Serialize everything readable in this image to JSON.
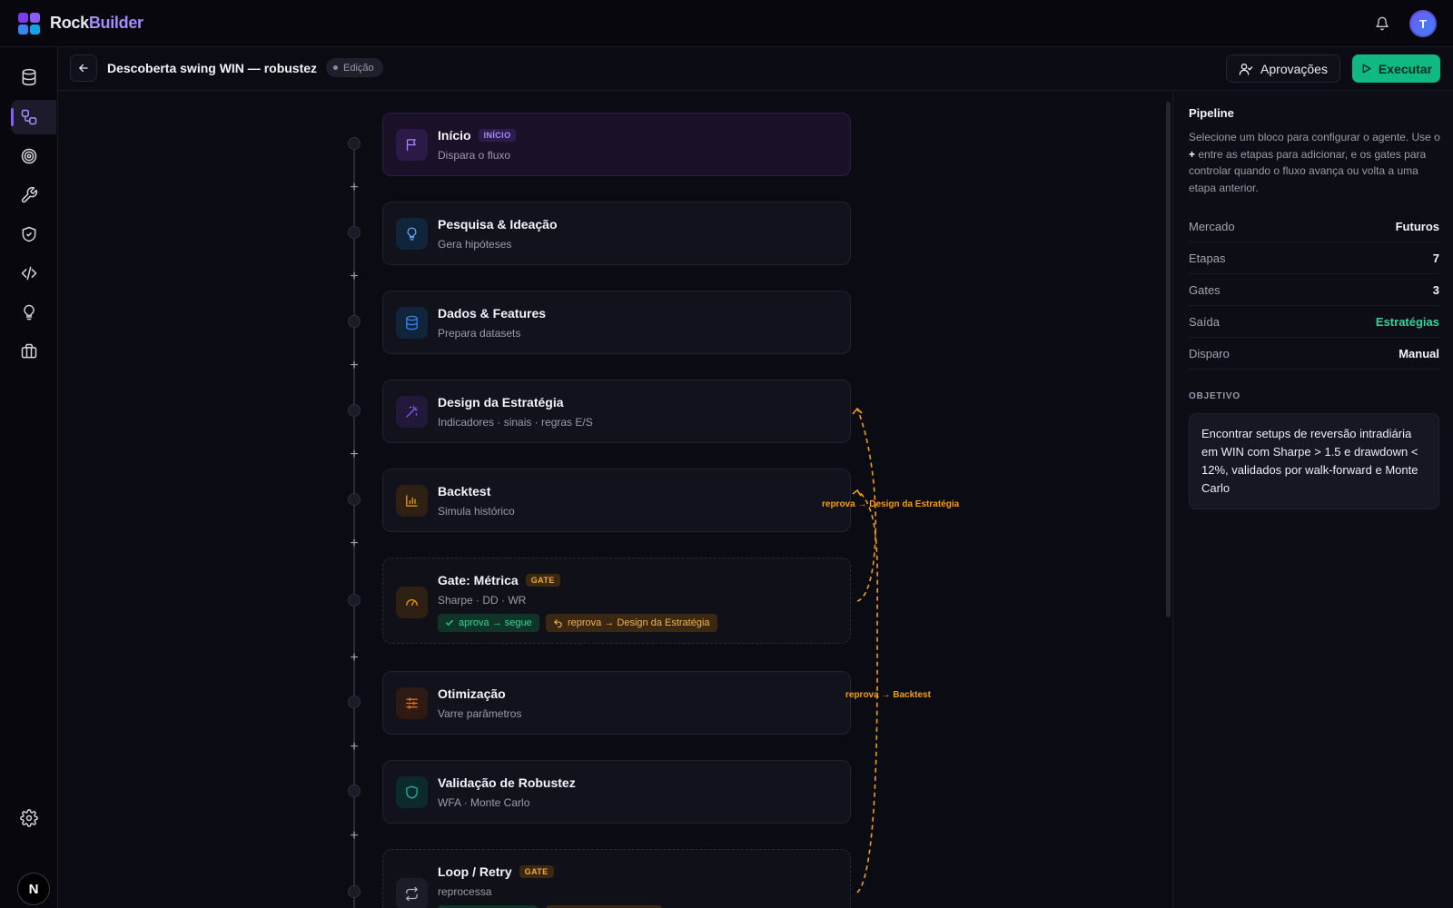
{
  "app": {
    "name_first": "Rock",
    "name_second": "Builder",
    "avatar_initial": "T",
    "bottom_avatar": "N"
  },
  "header": {
    "title": "Descoberta swing WIN — robustez",
    "status": "Edição",
    "approvals_label": "Aprovações",
    "execute_label": "Executar"
  },
  "sidebar": {
    "items": [
      {
        "name": "data",
        "icon": "database-icon"
      },
      {
        "name": "pipelines",
        "icon": "workflow-icon",
        "active": true
      },
      {
        "name": "targets",
        "icon": "target-icon"
      },
      {
        "name": "tools",
        "icon": "wrench-icon"
      },
      {
        "name": "security",
        "icon": "shield-check-icon"
      },
      {
        "name": "code",
        "icon": "code-icon"
      },
      {
        "name": "ideas",
        "icon": "lightbulb-icon"
      },
      {
        "name": "portfolio",
        "icon": "briefcase-icon"
      }
    ],
    "settings_icon": "gear-icon"
  },
  "flow": {
    "blocks": [
      {
        "title": "Início",
        "tag": "INÍCIO",
        "subtitle": "Dispara o fluxo",
        "icon": "flag-icon"
      },
      {
        "title": "Pesquisa & Ideação",
        "subtitle": "Gera hipóteses",
        "icon": "lightbulb-icon"
      },
      {
        "title": "Dados & Features",
        "subtitle": "Prepara datasets",
        "icon": "database-icon"
      },
      {
        "title": "Design da Estratégia",
        "subtitle": "Indicadores · sinais · regras E/S",
        "icon": "magic-wand-icon"
      },
      {
        "title": "Backtest",
        "subtitle": "Simula histórico",
        "icon": "bar-chart-icon"
      },
      {
        "title": "Gate: Métrica",
        "tag": "GATE",
        "subtitle": "Sharpe · DD · WR",
        "icon": "gauge-icon",
        "approve": "aprova → segue",
        "reject": "reprova → Design da Estratégia"
      },
      {
        "title": "Otimização",
        "subtitle": "Varre parâmetros",
        "icon": "sliders-icon"
      },
      {
        "title": "Validação de Robustez",
        "subtitle": "WFA · Monte Carlo",
        "icon": "shield-icon"
      },
      {
        "title": "Loop / Retry",
        "tag": "GATE",
        "subtitle": "reprocessa",
        "icon": "repeat-icon"
      }
    ],
    "loop_labels": {
      "metric_gate": "reprova → Design da Estratégia",
      "loop_retry": "reprova → Backtest"
    }
  },
  "panel": {
    "title": "Pipeline",
    "desc_before": "Selecione um bloco para configurar o agente. Use o ",
    "desc_plus": "+",
    "desc_after": " entre as etapas para adicionar, e os gates para controlar quando o fluxo avança ou volta a uma etapa anterior.",
    "stats": [
      {
        "key": "Mercado",
        "value": "Futuros"
      },
      {
        "key": "Etapas",
        "value": "7"
      },
      {
        "key": "Gates",
        "value": "3"
      },
      {
        "key": "Saída",
        "value": "Estratégias"
      },
      {
        "key": "Disparo",
        "value": "Manual"
      }
    ],
    "objective_label": "OBJETIVO",
    "objective_text": "Encontrar setups de reversão intradiária em WIN com Sharpe > 1.5 e drawdown < 12%, validados por walk-forward e Monte Carlo"
  },
  "colors": {
    "accent_purple": "#8b5cf6",
    "accent_green": "#10b981",
    "gate_orange": "#f59e0b"
  }
}
